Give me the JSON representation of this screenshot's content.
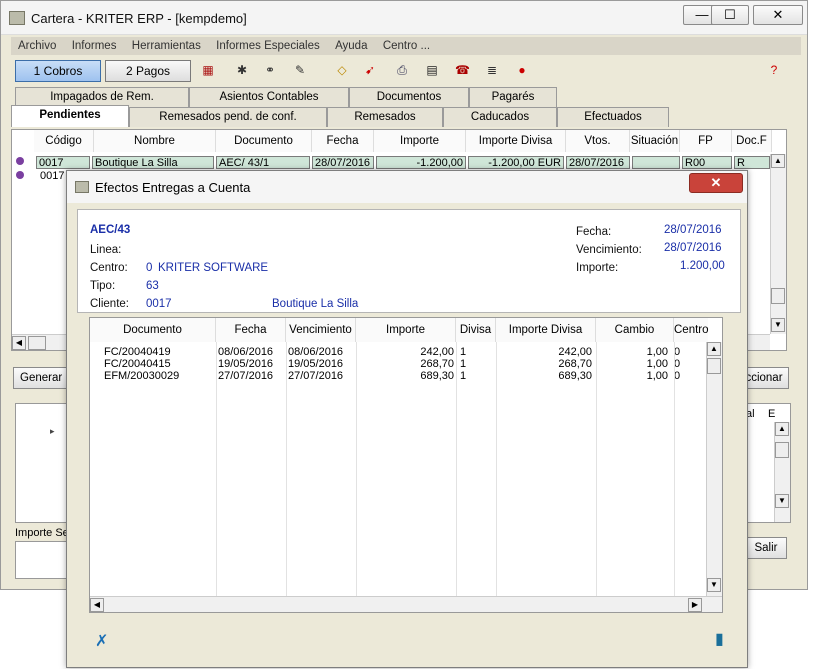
{
  "window": {
    "title": "Cartera - KRITER ERP - [kempdemo]",
    "min_label": "—",
    "max_label": "☐",
    "close_label": "✕"
  },
  "menu": [
    "Archivo",
    "Informes",
    "Herramientas",
    "Informes Especiales",
    "Ayuda",
    "Centro ..."
  ],
  "toolbar": {
    "btn1": "1 Cobros",
    "btn2": "2 Pagos"
  },
  "tabs_top": [
    "Impagados de Rem.",
    "Asientos Contables",
    "Documentos",
    "Pagarés"
  ],
  "tabs_bottom": [
    "Pendientes",
    "Remesados pend. de conf.",
    "Remesados",
    "Caducados",
    "Efectuados"
  ],
  "grid": {
    "headers": [
      "Código",
      "Nombre",
      "Documento",
      "Fecha",
      "Importe",
      "Importe Divisa",
      "Vtos.",
      "Situación",
      "FP",
      "Doc.F"
    ],
    "row1": {
      "codigo": "0017",
      "nombre": "Boutique La Silla",
      "documento": "AEC/ 43/1",
      "fecha": "28/07/2016",
      "importe": "-1.200,00",
      "importe_divisa": "-1.200,00 EUR",
      "vtos": "28/07/2016",
      "situacion": "",
      "fp": "R00",
      "docf": "R"
    },
    "row2_codigo": "0017"
  },
  "lower": {
    "generar": "Generar E",
    "seleccionar": "ccionar",
    "importe_se": "Importe Se",
    "salir": "Salir",
    "col_al": "al",
    "col_e": "E"
  },
  "dialog": {
    "title": "Efectos Entregas a Cuenta",
    "close_label": "✕",
    "doc_title": "AEC/43",
    "labels": {
      "linea": "Linea:",
      "centro": "Centro:",
      "tipo": "Tipo:",
      "cliente": "Cliente:",
      "fecha": "Fecha:",
      "vencimiento": "Vencimiento:",
      "importe": "Importe:"
    },
    "values": {
      "centro_code": "0",
      "centro_name": "KRITER SOFTWARE",
      "tipo": "63",
      "cliente_code": "0017",
      "cliente_name": "Boutique La Silla",
      "fecha": "28/07/2016",
      "vencimiento": "28/07/2016",
      "importe": "1.200,00"
    },
    "table": {
      "headers": [
        "Documento",
        "Fecha",
        "Vencimiento",
        "Importe",
        "Divisa",
        "Importe Divisa",
        "Cambio",
        "Centro"
      ],
      "rows": [
        {
          "documento": "FC/20040419",
          "fecha": "08/06/2016",
          "vencimiento": "08/06/2016",
          "importe": "242,00",
          "divisa": "1",
          "importe_divisa": "242,00",
          "cambio": "1,00",
          "centro": "0"
        },
        {
          "documento": "FC/20040415",
          "fecha": "19/05/2016",
          "vencimiento": "19/05/2016",
          "importe": "268,70",
          "divisa": "1",
          "importe_divisa": "268,70",
          "cambio": "1,00",
          "centro": "0"
        },
        {
          "documento": "EFM/20030029",
          "fecha": "27/07/2016",
          "vencimiento": "27/07/2016",
          "importe": "689,30",
          "divisa": "1",
          "importe_divisa": "689,30",
          "cambio": "1,00",
          "centro": "0"
        }
      ]
    }
  }
}
